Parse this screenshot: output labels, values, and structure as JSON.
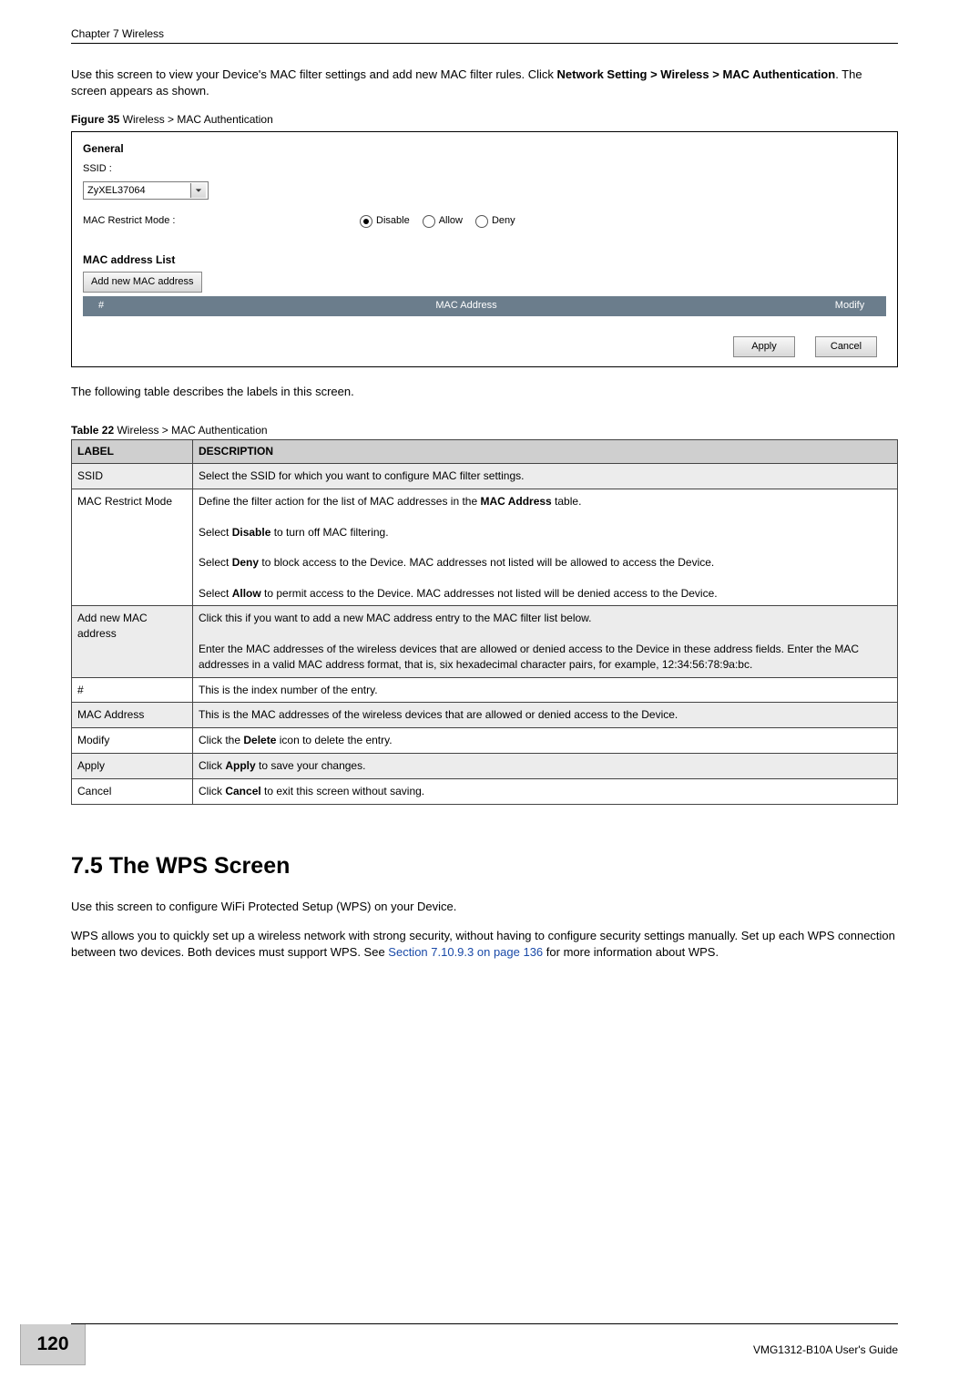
{
  "header": {
    "chapter": "Chapter 7 Wireless"
  },
  "intro": {
    "p1_a": "Use this screen to view your Device's MAC filter settings and add new MAC filter rules. Click ",
    "p1_b": "Network Setting > Wireless > MAC Authentication",
    "p1_c": ". The screen appears as shown."
  },
  "figure": {
    "caption_b": "Figure 35",
    "caption_t": "   Wireless > MAC Authentication",
    "general": "General",
    "ssid_label": "SSID :",
    "ssid_value": "ZyXEL37064",
    "restrict_label": "MAC Restrict Mode :",
    "radio_disable": "Disable",
    "radio_allow": "Allow",
    "radio_deny": "Deny",
    "list_title": "MAC address List",
    "add_btn": "Add new MAC address",
    "col_num": "#",
    "col_mac": "MAC Address",
    "col_mod": "Modify",
    "apply": "Apply",
    "cancel": "Cancel"
  },
  "mid_text": "The following table describes the labels in this screen.",
  "table": {
    "caption_b": "Table 22",
    "caption_t": "   Wireless > MAC Authentication",
    "hdr_label": "LABEL",
    "hdr_desc": "DESCRIPTION",
    "rows": [
      {
        "l": "SSID",
        "d": "Select the SSID for which you want to configure MAC filter settings."
      },
      {
        "l": "MAC Restrict Mode",
        "d": "Define the filter action for the list of MAC addresses in the <b>MAC Address</b> table.\n\nSelect <b>Disable</b> to turn off MAC filtering.\n\nSelect <b>Deny</b> to block access to the Device. MAC addresses not listed will be allowed to access the Device.\n\nSelect <b>Allow</b> to permit access to the Device. MAC addresses not listed will be denied access to the Device."
      },
      {
        "l": "Add new MAC address",
        "d": "Click this if you want to add a new MAC address entry to the MAC filter list below.\n\nEnter the MAC addresses of the wireless devices that are allowed or denied access to the Device in these address fields. Enter the MAC addresses in a valid MAC address format, that is, six hexadecimal character pairs, for example, 12:34:56:78:9a:bc."
      },
      {
        "l": "#",
        "d": "This is the index number of the entry."
      },
      {
        "l": "MAC Address",
        "d": "This is the MAC addresses of the wireless devices that are allowed or denied access to the Device."
      },
      {
        "l": "Modify",
        "d": "Click the <b>Delete</b> icon to delete the entry."
      },
      {
        "l": "Apply",
        "d": "Click <b>Apply</b> to save your changes."
      },
      {
        "l": "Cancel",
        "d": "Click <b>Cancel</b> to exit this screen without saving."
      }
    ]
  },
  "section": {
    "title": "7.5  The WPS Screen",
    "p1": "Use this screen to configure WiFi Protected Setup (WPS) on your Device.",
    "p2_a": "WPS allows you to quickly set up a wireless network with strong security, without having to configure security settings manually. Set up each WPS connection between two devices. Both devices must support WPS. See ",
    "p2_link": "Section 7.10.9.3 on page 136",
    "p2_b": " for more information about WPS."
  },
  "footer": {
    "page": "120",
    "guide": "VMG1312-B10A User's Guide"
  }
}
